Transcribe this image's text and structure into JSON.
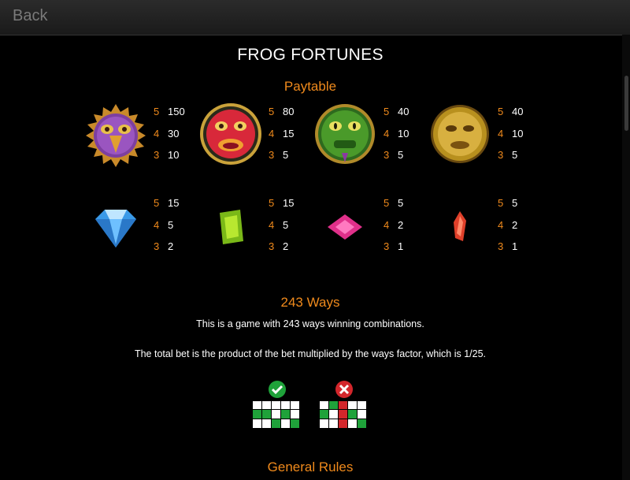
{
  "header": {
    "back_label": "Back"
  },
  "title": "FROG FORTUNES",
  "paytable": {
    "heading": "Paytable",
    "rows": [
      [
        {
          "icon": "bird-mask-icon",
          "pays": [
            {
              "n": "5",
              "v": "150"
            },
            {
              "n": "4",
              "v": "30"
            },
            {
              "n": "3",
              "v": "10"
            }
          ]
        },
        {
          "icon": "red-mask-icon",
          "pays": [
            {
              "n": "5",
              "v": "80"
            },
            {
              "n": "4",
              "v": "15"
            },
            {
              "n": "3",
              "v": "5"
            }
          ]
        },
        {
          "icon": "green-frog-mask-icon",
          "pays": [
            {
              "n": "5",
              "v": "40"
            },
            {
              "n": "4",
              "v": "10"
            },
            {
              "n": "3",
              "v": "5"
            }
          ]
        },
        {
          "icon": "gold-mask-icon",
          "pays": [
            {
              "n": "5",
              "v": "40"
            },
            {
              "n": "4",
              "v": "10"
            },
            {
              "n": "3",
              "v": "5"
            }
          ]
        }
      ],
      [
        {
          "icon": "blue-diamond-icon",
          "pays": [
            {
              "n": "5",
              "v": "15"
            },
            {
              "n": "4",
              "v": "5"
            },
            {
              "n": "3",
              "v": "2"
            }
          ]
        },
        {
          "icon": "green-gem-icon",
          "pays": [
            {
              "n": "5",
              "v": "15"
            },
            {
              "n": "4",
              "v": "5"
            },
            {
              "n": "3",
              "v": "2"
            }
          ]
        },
        {
          "icon": "pink-gem-icon",
          "pays": [
            {
              "n": "5",
              "v": "5"
            },
            {
              "n": "4",
              "v": "2"
            },
            {
              "n": "3",
              "v": "1"
            }
          ]
        },
        {
          "icon": "red-crystal-icon",
          "pays": [
            {
              "n": "5",
              "v": "5"
            },
            {
              "n": "4",
              "v": "2"
            },
            {
              "n": "3",
              "v": "1"
            }
          ]
        }
      ]
    ]
  },
  "ways": {
    "heading": "243 Ways",
    "line1": "This is a game with 243 ways winning combinations.",
    "line2": "The total bet is the product of the bet multiplied by the ways factor, which is 1/25."
  },
  "general_rules_heading": "General Rules",
  "colors": {
    "accent": "#f08a1c",
    "win": "#1fa23a",
    "lose": "#d3262b"
  }
}
